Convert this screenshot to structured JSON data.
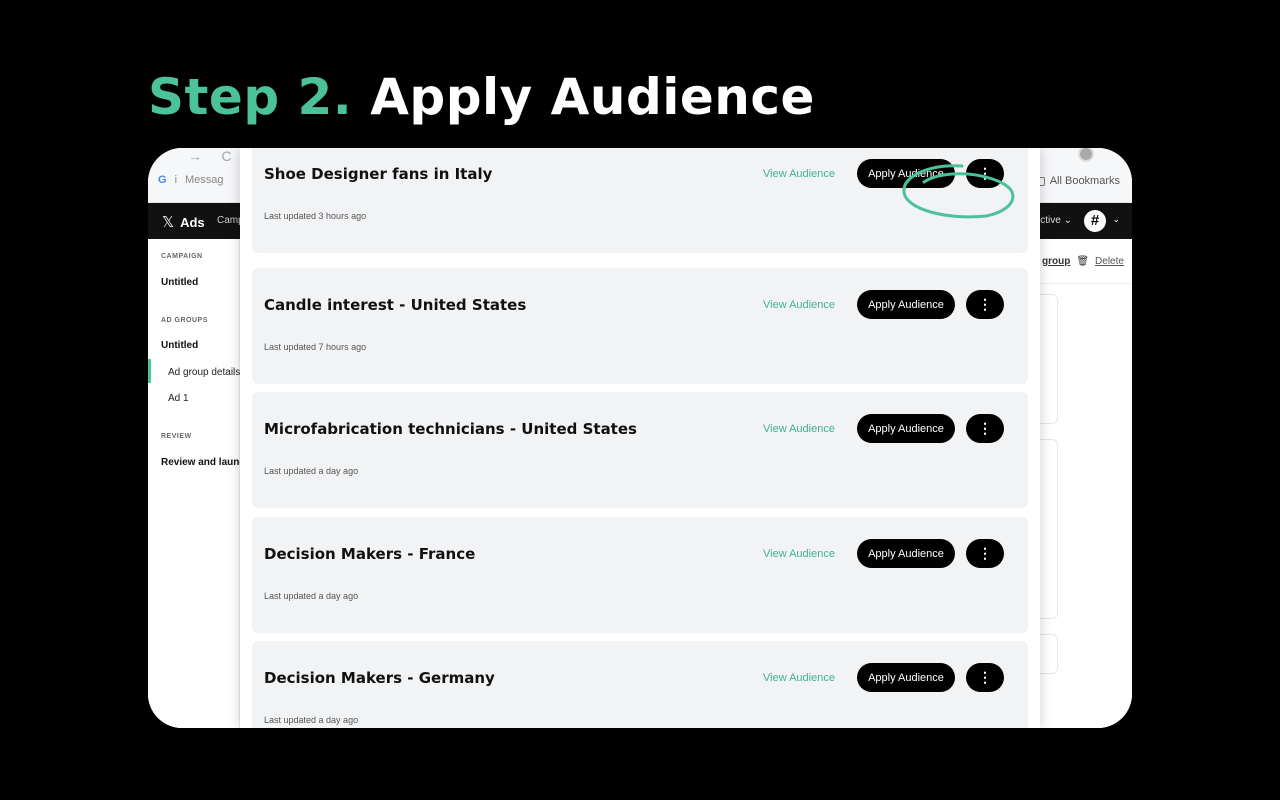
{
  "headline": {
    "step": "Step 2.",
    "title": "Apply Audience"
  },
  "browser": {
    "bookmark_g": "G",
    "bookmark_sep": "i",
    "bookmark_messages": "Messag",
    "all_bookmarks": "All Bookmarks",
    "nav_back": "→",
    "nav_reload": "C"
  },
  "appbar": {
    "logo_x": "𝕏",
    "logo_text": "Ads",
    "tab": "Camp",
    "status": "ctive ⌄",
    "avatar_glyph": "#",
    "chevron": "⌄"
  },
  "sidebar": {
    "campaign_section": "CAMPAIGN",
    "campaign_name": "Untitled",
    "adgroups_section": "AD GROUPS",
    "adgroup_name": "Untitled",
    "adgroup_details": "Ad group details",
    "ad1": "Ad 1",
    "review_section": "REVIEW",
    "review_launch": "Review and launch"
  },
  "rightbar": {
    "group_link": "group",
    "trash_glyph": "🗑",
    "delete_link": "Delete"
  },
  "audiences": [
    {
      "name": "Shoe Designer fans in Italy",
      "updated": "Last updated 3 hours ago",
      "view": "View Audience",
      "apply": "Apply Audience",
      "more": "⋮"
    },
    {
      "name": "Candle interest - United States",
      "updated": "Last updated 7 hours ago",
      "view": "View Audience",
      "apply": "Apply Audience",
      "more": "⋮"
    },
    {
      "name": "Microfabrication technicians - United States",
      "updated": "Last updated a day ago",
      "view": "View Audience",
      "apply": "Apply Audience",
      "more": "⋮"
    },
    {
      "name": "Decision Makers - France",
      "updated": "Last updated a day ago",
      "view": "View Audience",
      "apply": "Apply Audience",
      "more": "⋮"
    },
    {
      "name": "Decision Makers - Germany",
      "updated": "Last updated a day ago",
      "view": "View Audience",
      "apply": "Apply Audience",
      "more": "⋮"
    }
  ],
  "colors": {
    "accent": "#4cc29c",
    "link": "#3fb28d",
    "background": "#000000",
    "card": "#f2f3f5"
  }
}
